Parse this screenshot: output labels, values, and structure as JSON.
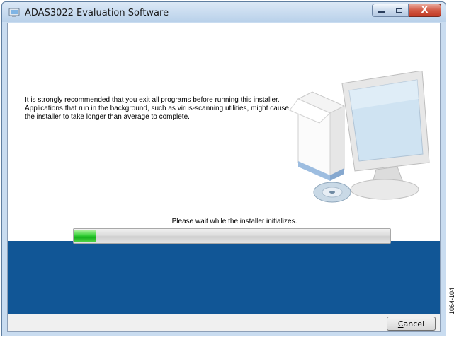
{
  "window": {
    "title": "ADAS3022 Evaluation Software",
    "app_icon": "installer-icon",
    "minimize_label": "minimize",
    "maximize_label": "maximize",
    "close_label": "X"
  },
  "main": {
    "message": "It is strongly recommended that you exit all programs before running this installer. Applications that run in the background, such as virus-scanning utilities, might cause the installer to take longer than average to complete.",
    "illustration": "computer-with-disc-icon",
    "status": "Please wait while the installer initializes.",
    "progress": 0.07
  },
  "footer": {
    "cancel_first": "C",
    "cancel_rest": "ancel"
  },
  "figure_number": "1064-104",
  "colors": {
    "band": "#115696",
    "progress": "#2ec42f"
  }
}
